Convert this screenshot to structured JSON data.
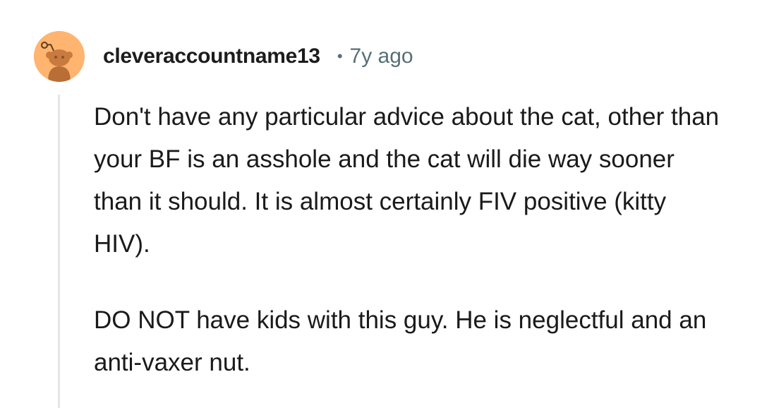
{
  "comment": {
    "username": "cleveraccountname13",
    "separator": "•",
    "age": "7y ago",
    "avatar_icon": "snoo-avatar-icon",
    "avatar_color": "#ffb470",
    "paragraphs": [
      "Don't have any particular advice about the cat, other than your BF is an asshole and the cat will die way sooner than it should. It is almost certainly FIV positive (kitty HIV).",
      "DO NOT have kids with this guy. He is neglectful and an anti-vaxer nut."
    ]
  }
}
